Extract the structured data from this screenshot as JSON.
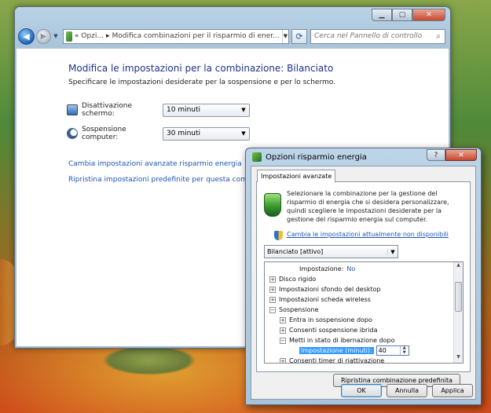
{
  "main_window": {
    "address_segments": [
      "«",
      "Opzi...",
      "Modifica combinazioni per il risparmio di ener..."
    ],
    "search_placeholder": "Cerca nel Pannello di controllo",
    "page_title": "Modifica le impostazioni per la combinazione: Bilanciato",
    "page_subtitle": "Specificare le impostazioni desiderate per la sospensione e per lo schermo.",
    "settings": [
      {
        "label": "Disattivazione schermo:",
        "value": "10 minuti",
        "icon": "monitor-icon"
      },
      {
        "label": "Sospensione computer:",
        "value": "30 minuti",
        "icon": "moon-icon"
      }
    ],
    "links": [
      "Cambia impostazioni avanzate risparmio energia",
      "Ripristina impostazioni predefinite per questa combinazione"
    ]
  },
  "dialog": {
    "title": "Opzioni risparmio energia",
    "help_label": "?",
    "close_label": "✕",
    "tab_label": "Impostazioni avanzate",
    "intro_text": "Selezionare la combinazione per la gestione del risparmio di energia che si desidera personalizzare, quindi scegliere le impostazioni desiderate per la gestione del risparmio energia sul computer.",
    "change_link": "Cambia le impostazioni attualmente non disponibili",
    "plan_value": "Bilanciato [attivo]",
    "tree": [
      {
        "text": "Impostazione:",
        "value": "No",
        "level": 3,
        "expander": ""
      },
      {
        "text": "Disco rigido",
        "level": 0,
        "expander": "+"
      },
      {
        "text": "Impostazioni sfondo del desktop",
        "level": 0,
        "expander": "+"
      },
      {
        "text": "Impostazioni scheda wireless",
        "level": 0,
        "expander": "+"
      },
      {
        "text": "Sospensione",
        "level": 0,
        "expander": "−"
      },
      {
        "text": "Entra in sospensione dopo",
        "level": 1,
        "expander": "+"
      },
      {
        "text": "Consenti sospensione ibrida",
        "level": 1,
        "expander": "+"
      },
      {
        "text": "Metti in stato di ibernazione dopo",
        "level": 1,
        "expander": "−"
      },
      {
        "text": "Impostazione (minuti):",
        "value": "40",
        "level": 2,
        "expander": "",
        "editing": true
      },
      {
        "text": "Consenti timer di riattivazione",
        "level": 1,
        "expander": "+"
      }
    ],
    "restore_button": "Ripristina combinazione predefinita",
    "ok_button": "OK",
    "cancel_button": "Annulla",
    "apply_button": "Applica"
  }
}
